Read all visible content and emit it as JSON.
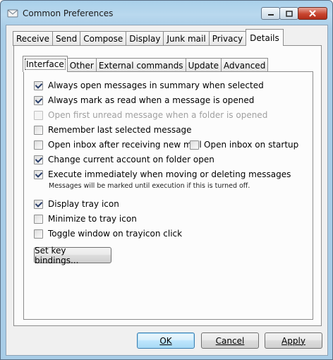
{
  "window": {
    "title": "Common Preferences"
  },
  "outer_tabs": [
    "Receive",
    "Send",
    "Compose",
    "Display",
    "Junk mail",
    "Privacy",
    "Details"
  ],
  "outer_active": "Details",
  "inner_tabs": [
    "Interface",
    "Other",
    "External commands",
    "Update",
    "Advanced"
  ],
  "inner_active": "Interface",
  "options": {
    "summary_open": {
      "label": "Always open messages in summary when selected",
      "checked": true,
      "disabled": false
    },
    "mark_read": {
      "label": "Always mark as read when a message is opened",
      "checked": true,
      "disabled": false
    },
    "open_first_unread": {
      "label": "Open first unread message when a folder is opened",
      "checked": false,
      "disabled": true
    },
    "remember_last": {
      "label": "Remember last selected message",
      "checked": false,
      "disabled": false
    },
    "open_inbox_after": {
      "label": "Open inbox after receiving new mail",
      "checked": false,
      "disabled": false
    },
    "open_inbox_startup": {
      "label": "Open inbox on startup",
      "checked": false,
      "disabled": false
    },
    "change_account": {
      "label": "Change current account on folder open",
      "checked": true,
      "disabled": false
    },
    "execute_immediately": {
      "label": "Execute immediately when moving or deleting messages",
      "checked": true,
      "disabled": false
    },
    "tray_icon": {
      "label": "Display tray icon",
      "checked": true,
      "disabled": false
    },
    "minimize_tray": {
      "label": "Minimize to tray icon",
      "checked": false,
      "disabled": false
    },
    "toggle_window": {
      "label": "Toggle window on trayicon click",
      "checked": false,
      "disabled": false
    }
  },
  "execute_note": "Messages will be marked until execution if this is turned off.",
  "buttons": {
    "key_bindings": "Set key bindings...",
    "ok": "OK",
    "cancel": "Cancel",
    "apply": "Apply"
  },
  "colors": {
    "title_bar": "#b9d8ee",
    "close_button": "#c8452f",
    "default_button_border": "#3c7fb1"
  }
}
